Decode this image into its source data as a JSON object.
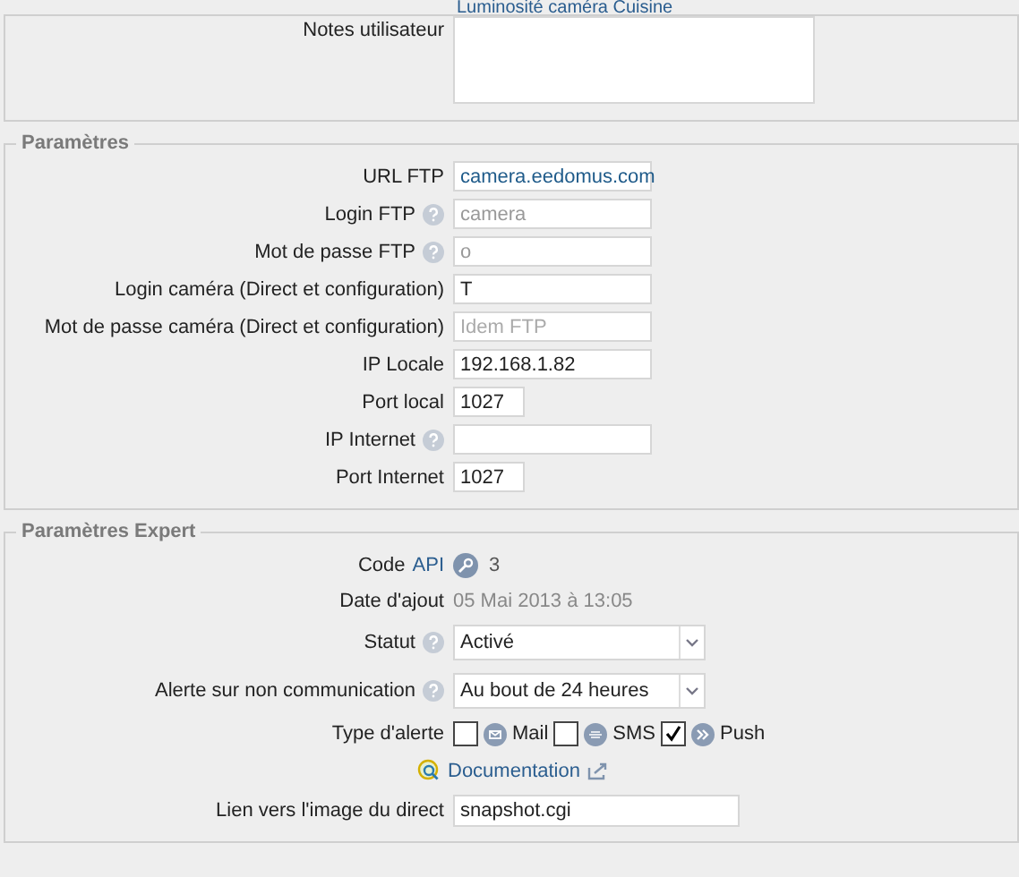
{
  "top_link": {
    "label": "Luminosité caméra Cuisine"
  },
  "notes": {
    "label": "Notes utilisateur"
  },
  "parametres": {
    "legend": "Paramètres",
    "fields": [
      {
        "label": "URL FTP",
        "value": "camera.eedomus.com",
        "help": false,
        "kind": "link"
      },
      {
        "label": "Login FTP",
        "value": "camera",
        "help": true,
        "kind": "disabled"
      },
      {
        "label": "Mot de passe FTP",
        "value": "o",
        "help": true,
        "kind": "disabled"
      },
      {
        "label": "Login caméra (Direct et configuration)",
        "value": "T",
        "help": false,
        "kind": "text"
      },
      {
        "label": "Mot de passe caméra (Direct et configuration)",
        "placeholder": "Idem FTP",
        "help": false,
        "kind": "text"
      },
      {
        "label": "IP Locale",
        "value": "192.168.1.82",
        "help": false,
        "kind": "text"
      },
      {
        "label": "Port local",
        "value": "1027",
        "help": false,
        "kind": "port"
      },
      {
        "label": "IP Internet",
        "help": true,
        "kind": "text"
      },
      {
        "label": "Port Internet",
        "value": "1027",
        "help": false,
        "kind": "port"
      }
    ]
  },
  "expert": {
    "legend": "Paramètres Expert",
    "code": {
      "label": "Code",
      "link": "API",
      "value": "3"
    },
    "date": {
      "label": "Date d'ajout",
      "value": "05 Mai 2013 à 13:05"
    },
    "selects": [
      {
        "label": "Statut",
        "value": "Activé",
        "help": true
      },
      {
        "label": "Alerte sur non communication",
        "value": "Au bout de 24 heures",
        "help": true
      }
    ],
    "alert_types": {
      "label": "Type d'alerte",
      "options": [
        {
          "label": "Mail",
          "kind": "mail",
          "checked": false
        },
        {
          "label": "SMS",
          "kind": "sms",
          "checked": false
        },
        {
          "label": "Push",
          "kind": "push",
          "checked": true
        }
      ]
    },
    "documentation": {
      "label": "Documentation"
    },
    "live_image": {
      "label": "Lien vers l'image du direct",
      "value": "snapshot.cgi"
    }
  }
}
